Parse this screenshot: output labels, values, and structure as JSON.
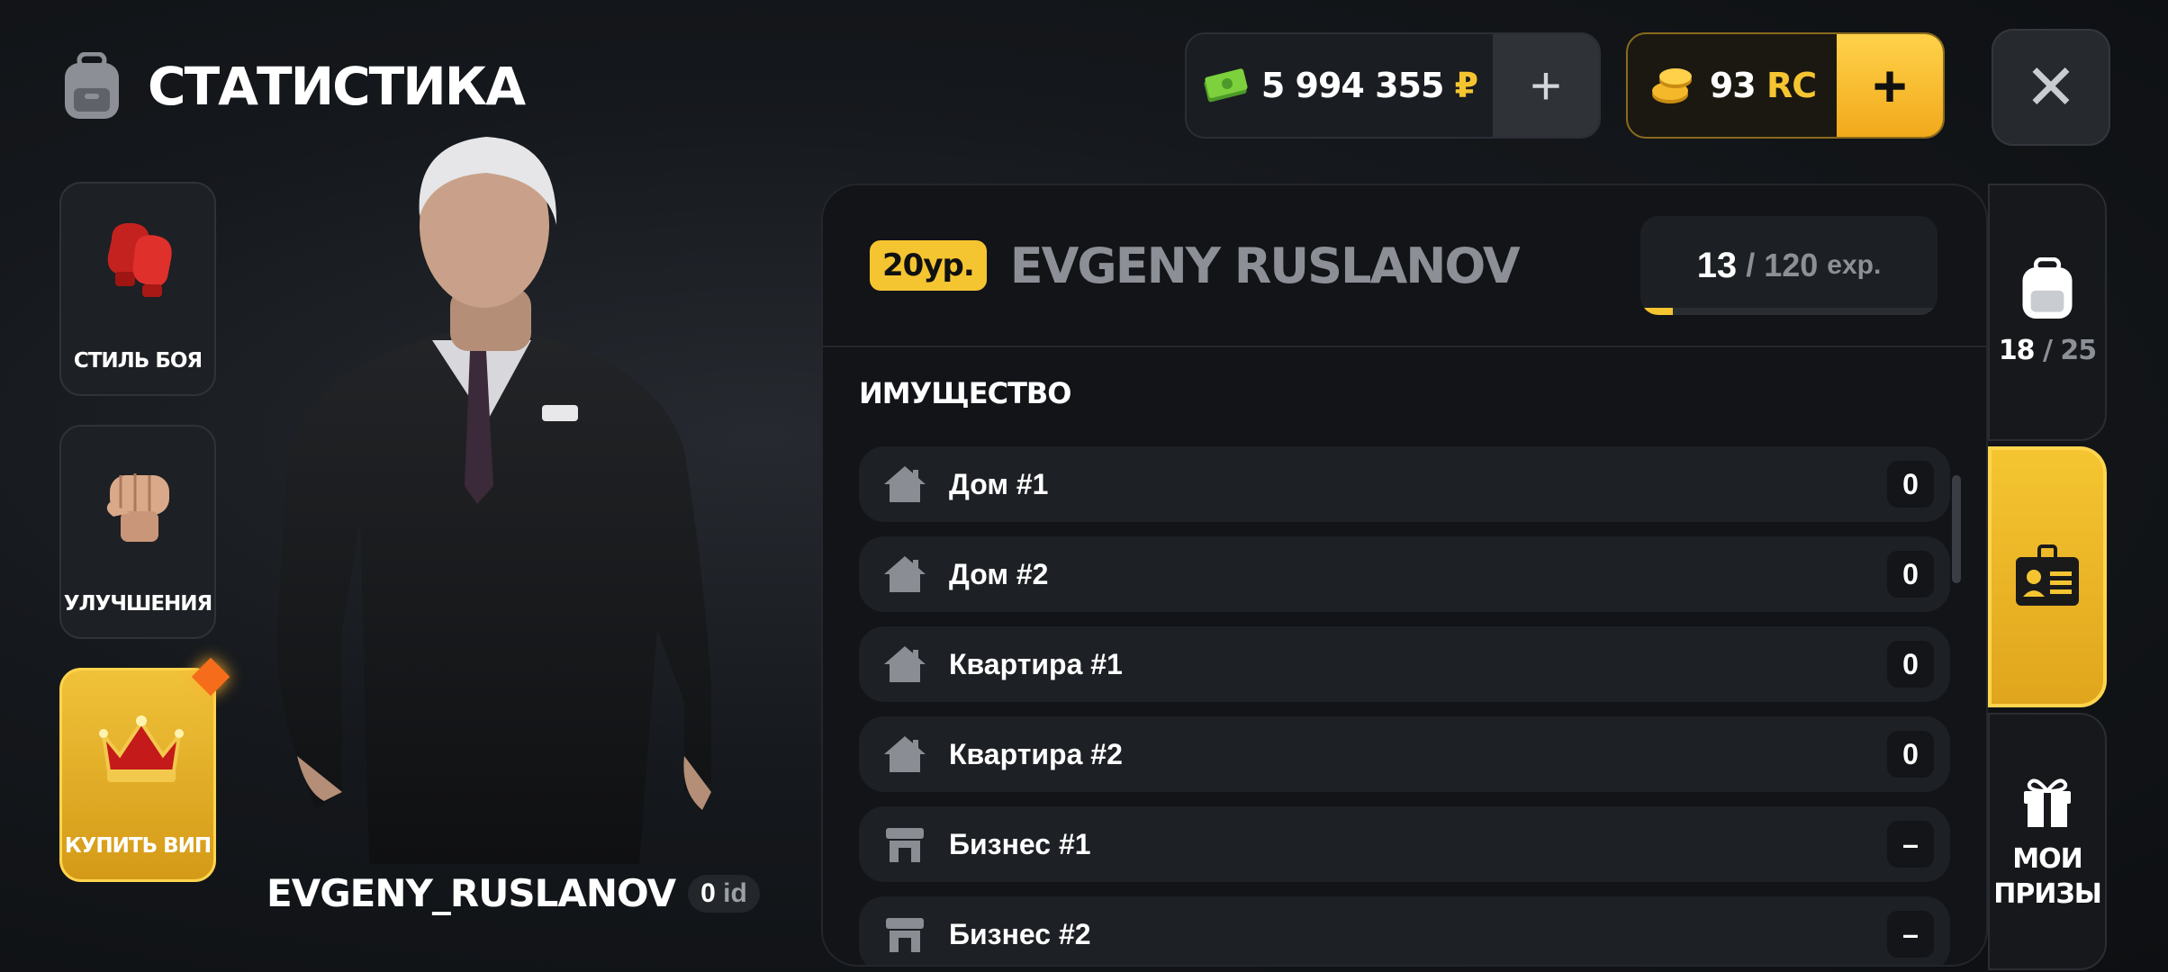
{
  "header": {
    "title": "СТАТИСТИКА",
    "icon": "backpack-icon"
  },
  "currency": {
    "money": {
      "amount": "5 994 355",
      "symbol": "₽",
      "icon": "cash-icon",
      "add_label": "+"
    },
    "rc": {
      "amount": "93",
      "unit": "RC",
      "icon": "coins-icon",
      "add_label": "+"
    },
    "close_label": "✕"
  },
  "side_menu": [
    {
      "label": "СТИЛЬ БОЯ",
      "icon": "boxing-gloves-icon"
    },
    {
      "label": "УЛУЧШЕНИЯ",
      "icon": "fist-icon"
    },
    {
      "label": "КУПИТЬ ВИП",
      "icon": "crown-icon"
    }
  ],
  "character": {
    "name": "EVGENY_RUSLANOV",
    "id_value": "0",
    "id_label": "id"
  },
  "profile": {
    "level_badge": "20ур.",
    "player_name": "EVGENY RUSLANOV",
    "exp_current": "13",
    "exp_rest": "/ 120",
    "exp_unit": "exp.",
    "exp_progress": 0.11
  },
  "property": {
    "title": "ИМУЩЕСТВО",
    "items": [
      {
        "name": "Дом #1",
        "value": "0",
        "icon": "house-icon"
      },
      {
        "name": "Дом #2",
        "value": "0",
        "icon": "house-icon"
      },
      {
        "name": "Квартира #1",
        "value": "0",
        "icon": "house-icon"
      },
      {
        "name": "Квартира #2",
        "value": "0",
        "icon": "house-icon"
      },
      {
        "name": "Бизнес #1",
        "value": "–",
        "icon": "shop-icon"
      },
      {
        "name": "Бизнес #2",
        "value": "–",
        "icon": "shop-icon"
      }
    ]
  },
  "right_tabs": {
    "inventory": {
      "current": "18",
      "total": "/ 25",
      "icon": "backpack-icon"
    },
    "profile": {
      "icon": "id-card-icon"
    },
    "prizes": {
      "label_line1": "МОИ",
      "label_line2": "ПРИЗЫ",
      "icon": "gift-icon"
    }
  },
  "colors": {
    "accent": "#f5c531",
    "panel": "#121418",
    "row": "#1d2024"
  }
}
